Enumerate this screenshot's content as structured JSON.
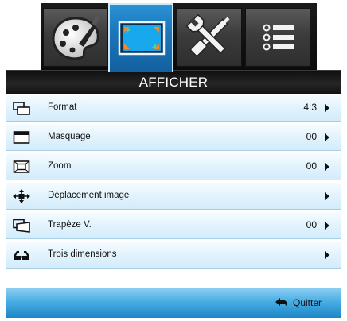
{
  "tabs": [
    {
      "name": "palette-tab",
      "icon": "palette-brush-icon"
    },
    {
      "name": "display-tab",
      "icon": "display-screen-icon",
      "active": true
    },
    {
      "name": "settings-tab",
      "icon": "wrench-screwdriver-icon"
    },
    {
      "name": "options-tab",
      "icon": "list-options-icon"
    }
  ],
  "header": {
    "title": "AFFICHER"
  },
  "menu": {
    "items": [
      {
        "label": "Format",
        "value": "4:3",
        "icon": "format-icon"
      },
      {
        "label": "Masquage",
        "value": "00",
        "icon": "masking-icon"
      },
      {
        "label": "Zoom",
        "value": "00",
        "icon": "zoom-icon"
      },
      {
        "label": "Déplacement image",
        "value": "",
        "icon": "image-shift-icon"
      },
      {
        "label": "Trapèze V.",
        "value": "00",
        "icon": "keystone-icon"
      },
      {
        "label": "Trois dimensions",
        "value": "",
        "icon": "3d-glasses-icon"
      }
    ]
  },
  "footer": {
    "quit_label": "Quitter",
    "quit_icon": "return-arrow-icon"
  },
  "colors": {
    "accent": "#1e79bd",
    "row_bg": "#e2f3fd",
    "header_bg": "#1a1a1a"
  }
}
